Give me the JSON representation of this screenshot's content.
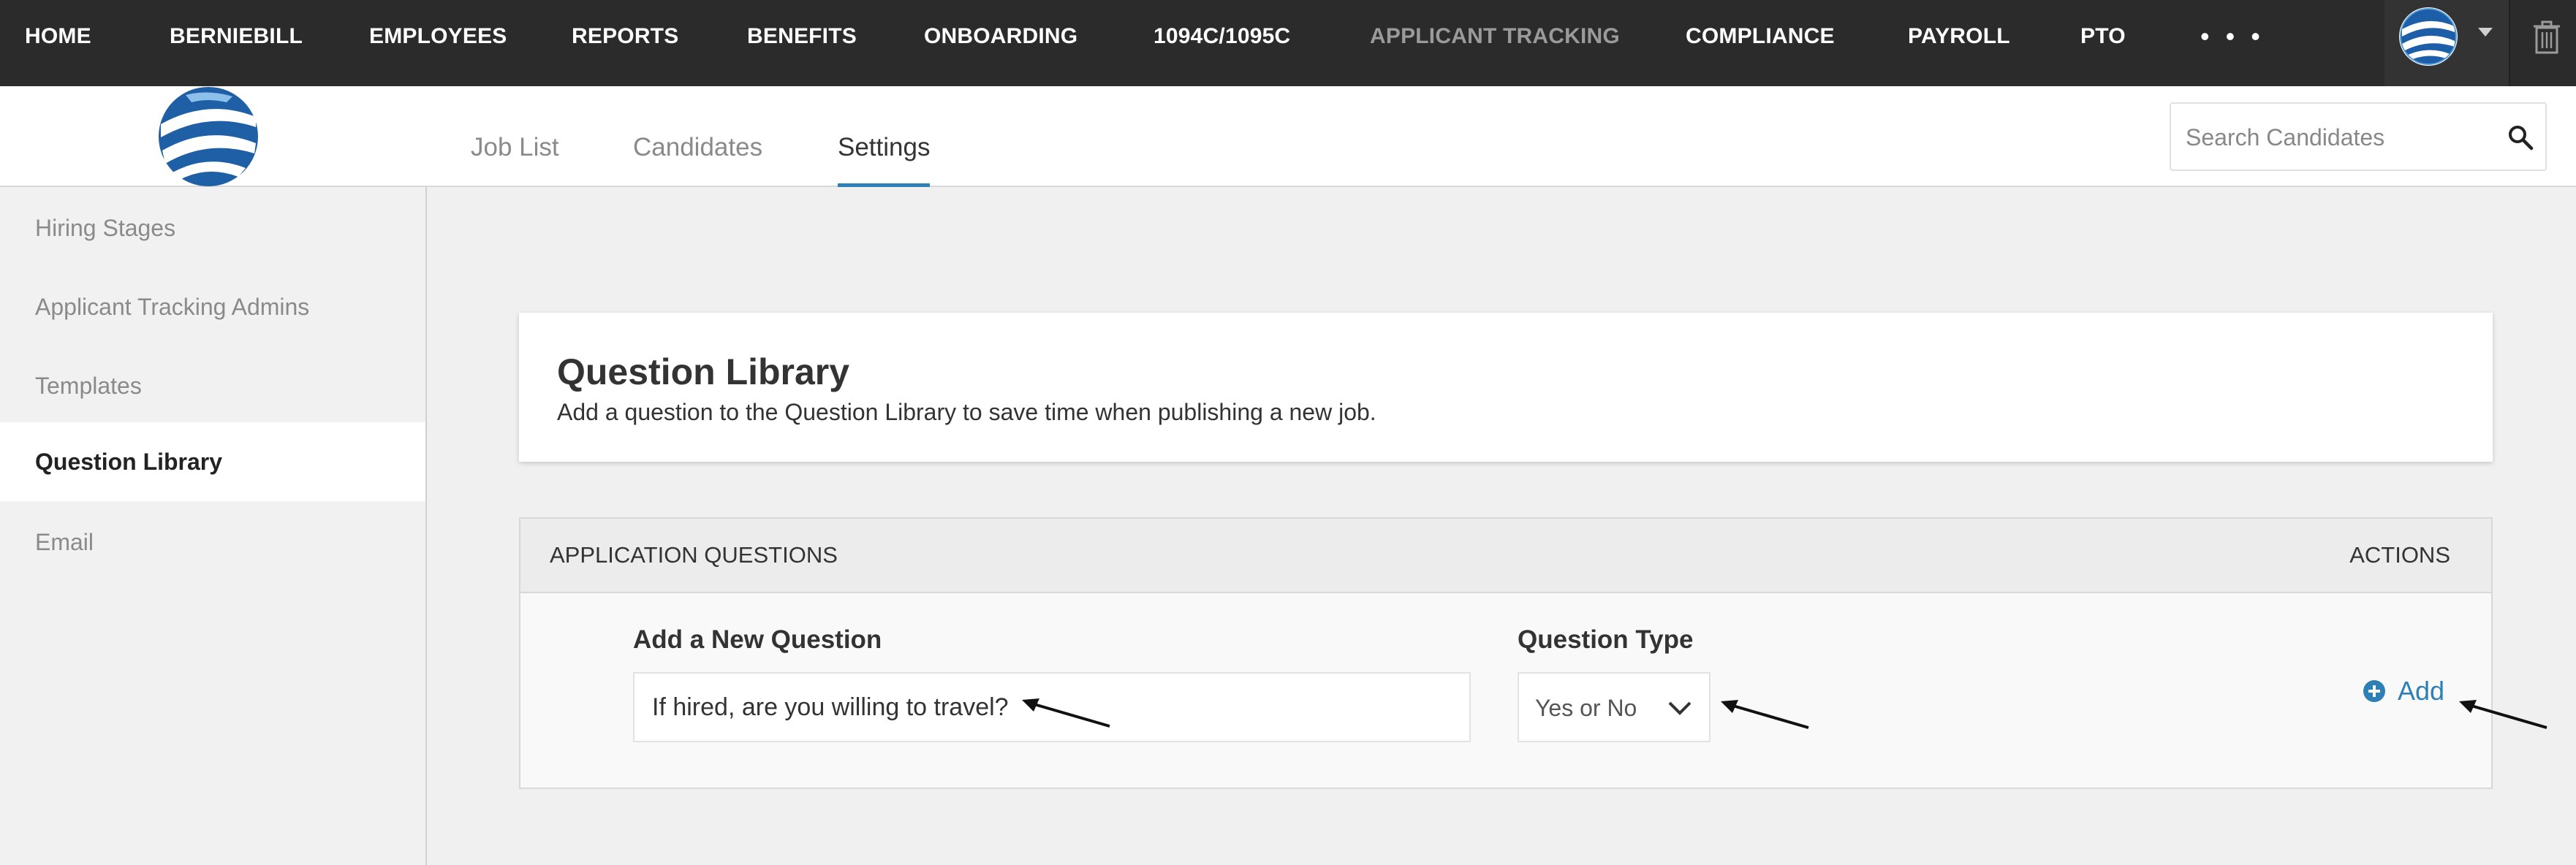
{
  "topnav": {
    "items": [
      {
        "label": "HOME"
      },
      {
        "label": "BERNIEBILL"
      },
      {
        "label": "EMPLOYEES"
      },
      {
        "label": "REPORTS"
      },
      {
        "label": "BENEFITS"
      },
      {
        "label": "ONBOARDING"
      },
      {
        "label": "1094C/1095C"
      },
      {
        "label": "APPLICANT TRACKING",
        "active": true
      },
      {
        "label": "COMPLIANCE"
      },
      {
        "label": "PAYROLL"
      },
      {
        "label": "PTO"
      }
    ],
    "more_label": "• • •"
  },
  "tabs": [
    {
      "label": "Job List"
    },
    {
      "label": "Candidates"
    },
    {
      "label": "Settings",
      "active": true
    }
  ],
  "search": {
    "placeholder": "Search Candidates"
  },
  "sidebar": {
    "items": [
      {
        "label": "Hiring Stages"
      },
      {
        "label": "Applicant Tracking Admins"
      },
      {
        "label": "Templates"
      },
      {
        "label": "Question Library",
        "active": true
      },
      {
        "label": "Email"
      }
    ]
  },
  "card": {
    "title": "Question Library",
    "description": "Add a question to the Question Library to save time when publishing a new job."
  },
  "panel": {
    "header_left": "APPLICATION QUESTIONS",
    "header_right": "ACTIONS",
    "new_question_label": "Add a New Question",
    "new_question_value": "If hired, are you willing to travel?",
    "question_type_label": "Question Type",
    "question_type_value": "Yes or No",
    "add_label": "Add"
  },
  "colors": {
    "nav_bg": "#2b2b2b",
    "accent": "#2e7fb5",
    "active_nav_text": "#9a9a9a"
  }
}
